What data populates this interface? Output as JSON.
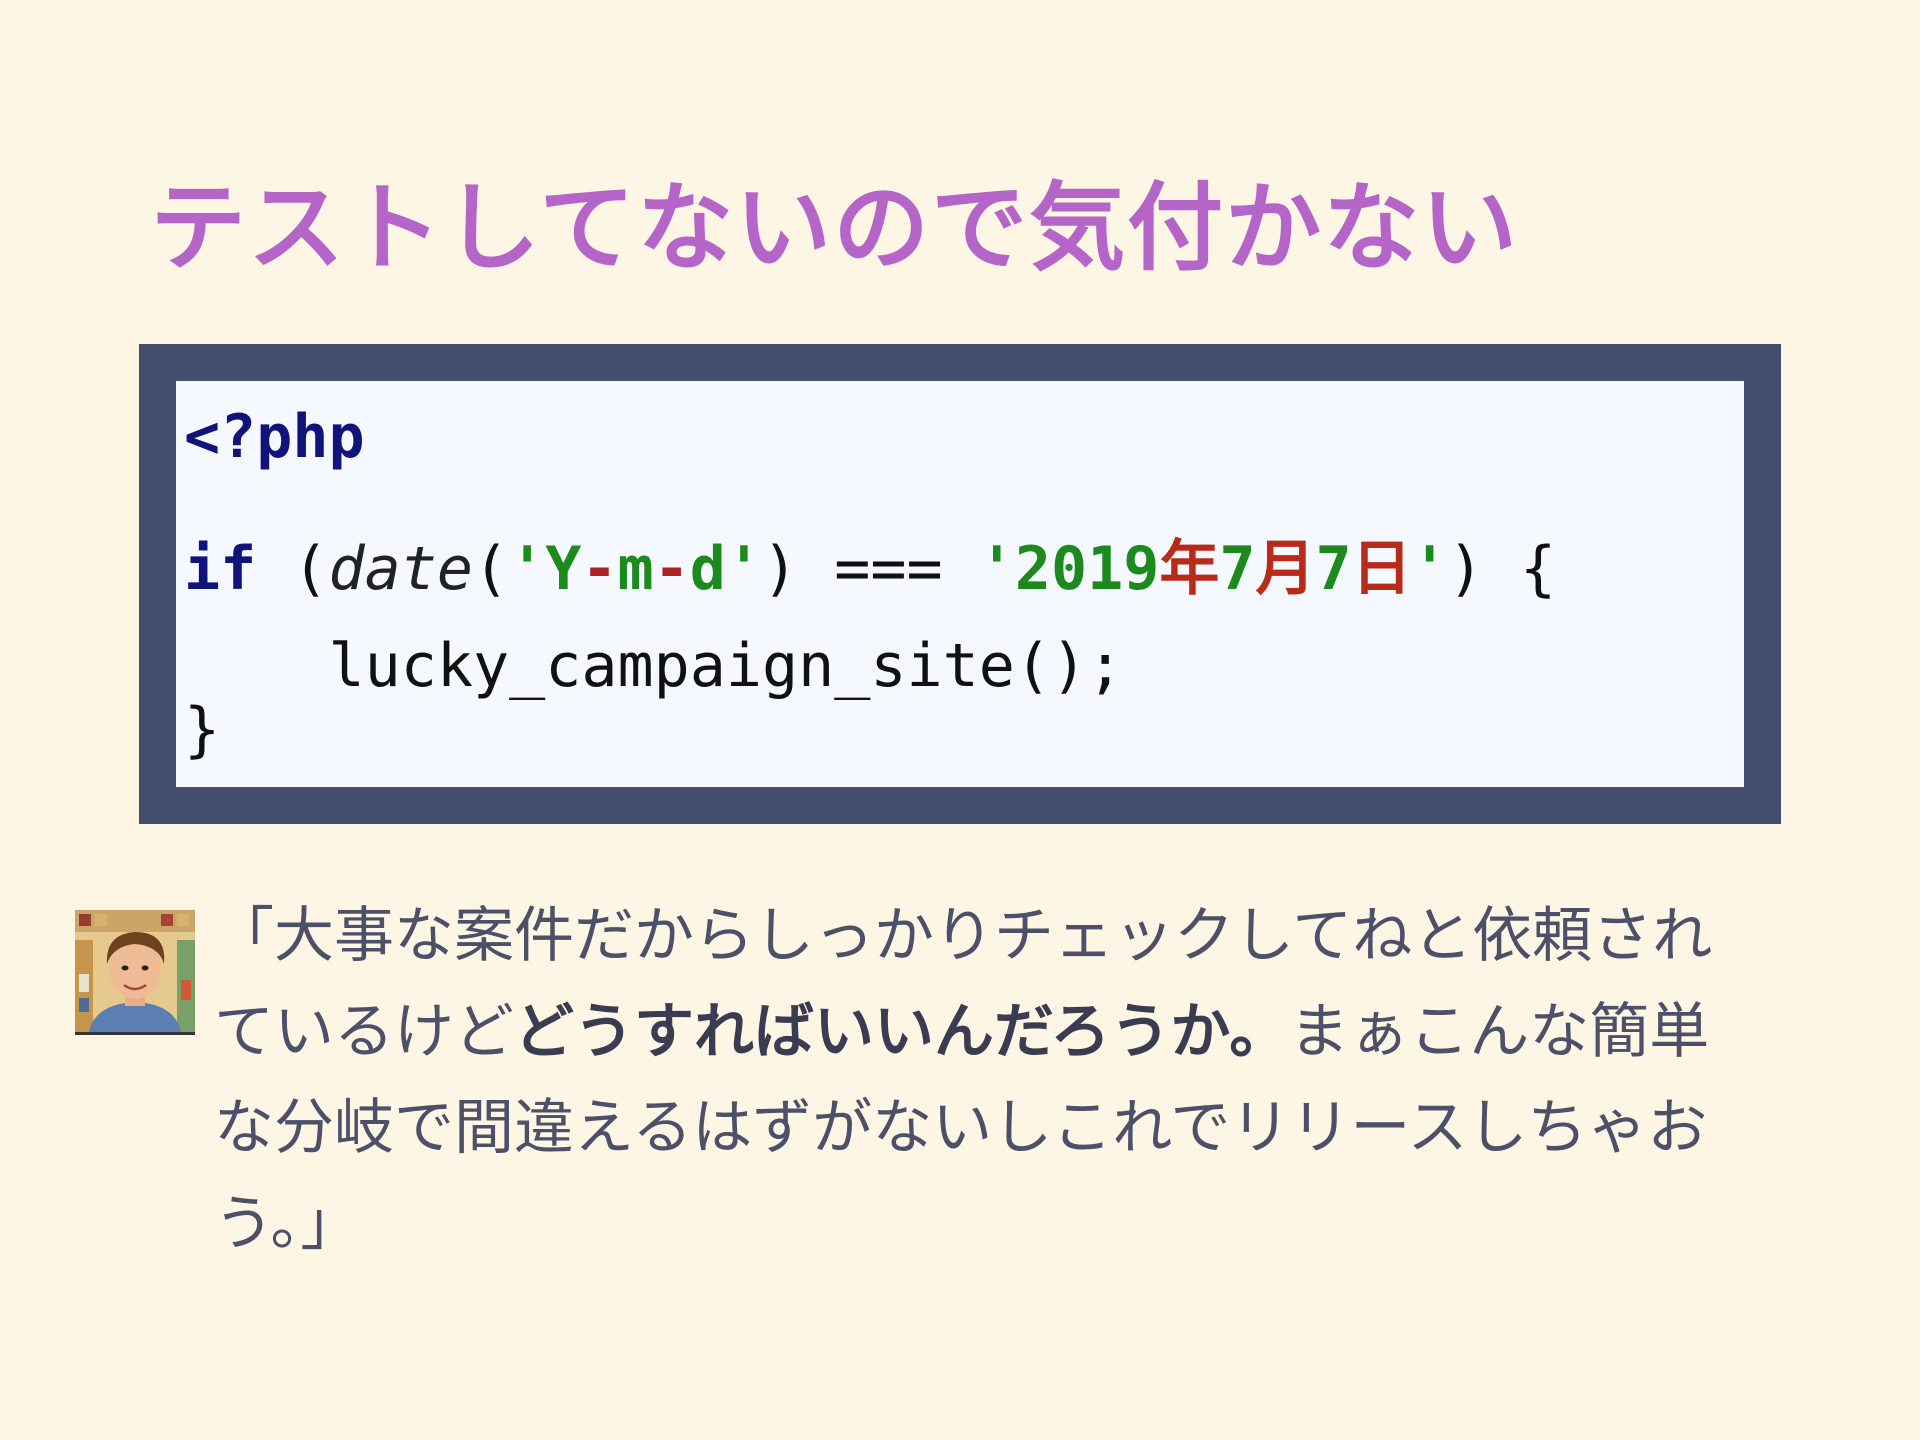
{
  "slide": {
    "title": "テストしてないので気付かない"
  },
  "code": {
    "open_tag": "<?php",
    "kw_if": "if",
    "paren_open": " (",
    "fn_date": "date",
    "paren2": "(",
    "str_y": "'Y",
    "dash1": "-",
    "str_m": "m",
    "dash2": "-",
    "str_d": "d'",
    "compare": ") === ",
    "str_2019": "'2019",
    "cjk_year": "年",
    "str_7a": "7",
    "cjk_month": "月",
    "str_7b": "7",
    "cjk_day": "日",
    "str_close": "'",
    "tail": ") {",
    "call": "    lucky_campaign_site();",
    "close_brace": "}"
  },
  "quote": {
    "part1": "「大事な案件だからしっかりチェックしてねと依頼されているけど",
    "bold": "どうすればいいんだろうか。",
    "part2": "まぁこんな簡単な分岐で間違えるはずがないしこれでリリースしちゃおう。」"
  }
}
